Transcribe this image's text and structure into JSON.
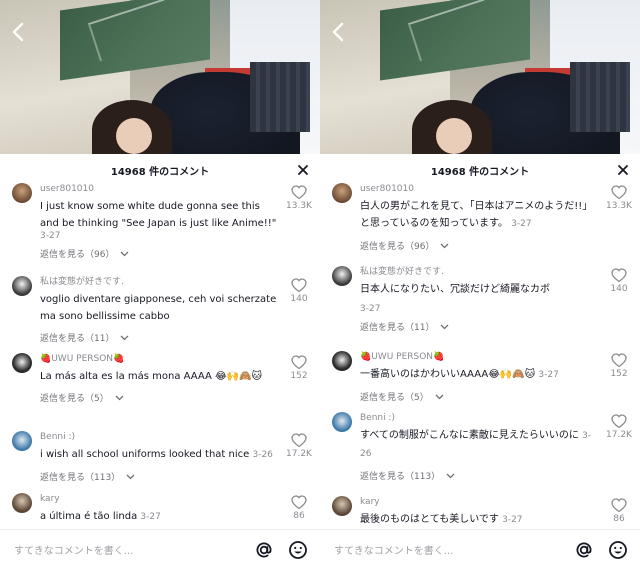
{
  "header": {
    "title": "14968 件のコメント"
  },
  "input": {
    "placeholder": "すてきなコメントを書く..."
  },
  "left": {
    "comments": [
      {
        "user": "user801010",
        "text": "I just know some white dude gonna see this and be thinking \"See Japan is just like Anime!!\"",
        "date": "3-27",
        "replies": "返信を見る（96）",
        "likes": "13.3K"
      },
      {
        "user": "私は変態が好きです.",
        "text": "voglio diventare giapponese, ceh voi scherzate ma sono bellissime cabbo",
        "date": "3-27",
        "replies": "返信を見る（11）",
        "likes": "140"
      },
      {
        "user": "🍓UWU PERSON🍓",
        "text": "La más alta es la más mona AAAA 😂🙌🙈🐱",
        "date": "3-27",
        "replies": "返信を見る（5）",
        "likes": "152"
      },
      {
        "user": "Benni :)",
        "text": "i wish all school uniforms looked that nice",
        "date": "3-26",
        "replies": "返信を見る（113）",
        "likes": "17.2K"
      },
      {
        "user": "kary",
        "text": "a última é tão linda",
        "date": "3-27",
        "replies": "",
        "likes": "86"
      }
    ]
  },
  "right": {
    "comments": [
      {
        "user": "user801010",
        "text": "白人の男がこれを見て、「日本はアニメのようだ!!」と思っているのを知っています。",
        "date": "3-27",
        "replies": "返信を見る（96）",
        "likes": "13.3K"
      },
      {
        "user": "私は変態が好きです.",
        "text": "日本人になりたい、冗談だけど綺麗なカボ",
        "date": "3-27",
        "replies": "返信を見る（11）",
        "likes": "140"
      },
      {
        "user": "🍓UWU PERSON🍓",
        "text": "一番高いのはかわいいAAAA😂🙌🙈🐱",
        "date": "3-27",
        "replies": "返信を見る（5）",
        "likes": "152"
      },
      {
        "user": "Benni :)",
        "text": "すべての制服がこんなに素敵に見えたらいいのに",
        "date": "3-26",
        "replies": "返信を見る（113）",
        "likes": "17.2K"
      },
      {
        "user": "kary",
        "text": "最後のものはとても美しいです",
        "date": "3-27",
        "replies": "",
        "likes": "86"
      }
    ]
  },
  "icons": {
    "back": "chevron-left-icon",
    "close": "close-icon",
    "like": "heart-outline-icon",
    "expand": "chevron-down-icon",
    "mention": "at-sign-icon",
    "emoji": "smiley-icon"
  },
  "colors": {
    "text": "#161823",
    "muted": "#8a8b91",
    "placeholder": "#a1a2a7"
  }
}
